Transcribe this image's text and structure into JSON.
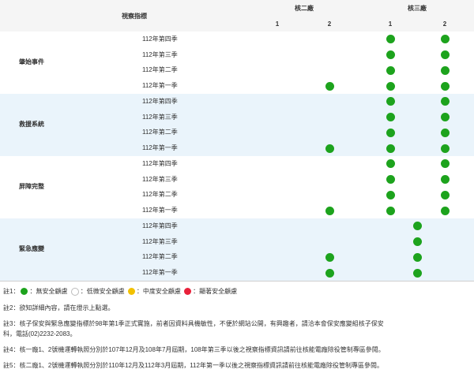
{
  "header": {
    "indicator": "視察指標",
    "unit2": "核二廠",
    "unit3": "核三廠",
    "u2_1": "1",
    "u2_2": "2",
    "u3_1": "1",
    "u3_2": "2"
  },
  "groups": [
    {
      "label": "肇始事件",
      "quarters": [
        "112年第四季",
        "112年第三季",
        "112年第二季",
        "112年第一季"
      ],
      "dots": [
        [
          0,
          0,
          1,
          1
        ],
        [
          0,
          0,
          1,
          1
        ],
        [
          0,
          0,
          1,
          1
        ],
        [
          0,
          1,
          1,
          1
        ]
      ]
    },
    {
      "label": "救援系統",
      "quarters": [
        "112年第四季",
        "112年第三季",
        "112年第二季",
        "112年第一季"
      ],
      "dots": [
        [
          0,
          0,
          1,
          1
        ],
        [
          0,
          0,
          1,
          1
        ],
        [
          0,
          0,
          1,
          1
        ],
        [
          0,
          1,
          1,
          1
        ]
      ]
    },
    {
      "label": "屏障完整",
      "quarters": [
        "112年第四季",
        "112年第三季",
        "112年第二季",
        "112年第一季"
      ],
      "dots": [
        [
          0,
          0,
          1,
          1
        ],
        [
          0,
          0,
          1,
          1
        ],
        [
          0,
          0,
          1,
          1
        ],
        [
          0,
          1,
          1,
          1
        ]
      ]
    },
    {
      "label": "緊急應變",
      "quarters": [
        "112年第四季",
        "112年第三季",
        "112年第二季",
        "112年第一季"
      ],
      "dots": [
        [
          0,
          0,
          "m",
          0
        ],
        [
          0,
          0,
          "m",
          0
        ],
        [
          0,
          1,
          "m",
          0
        ],
        [
          0,
          1,
          "m",
          0
        ]
      ]
    }
  ],
  "colors": {
    "green": "#1da31d",
    "white": "#ffffff",
    "yellow": "#f2c100",
    "red": "#e8213a",
    "alt_bg": "#eaf4fb"
  },
  "notes": {
    "n1_prefix": "註1：",
    "n1_green": "：無安全顧慮",
    "n1_white": "：低微安全顧慮",
    "n1_yellow": "：中度安全顧慮",
    "n1_red": "：顯著安全顧慮",
    "n2": "註2：欲知詳細內容，請在燈示上點選。",
    "n3a": "註3：核子保安與緊急應變指標於98年第1季正式實施，前者因資料具機敏性，不便於網站公開，有興趣者，請洽本會保安應變組核子保安",
    "n3b": "科，電話(02)2232-2083。",
    "n4": "註4：核一廠1、2號機運轉執照分別於107年12月及108年7月屆期，108年第三季以後之視察指標資訊請前往核能電廠除役管制專區參閱。",
    "n5": "註5：核二廠1、2號機運轉執照分別於110年12月及112年3月屆期，112年第一季以後之視察指標資訊請前往核能電廠除役管制專區參閱。"
  }
}
